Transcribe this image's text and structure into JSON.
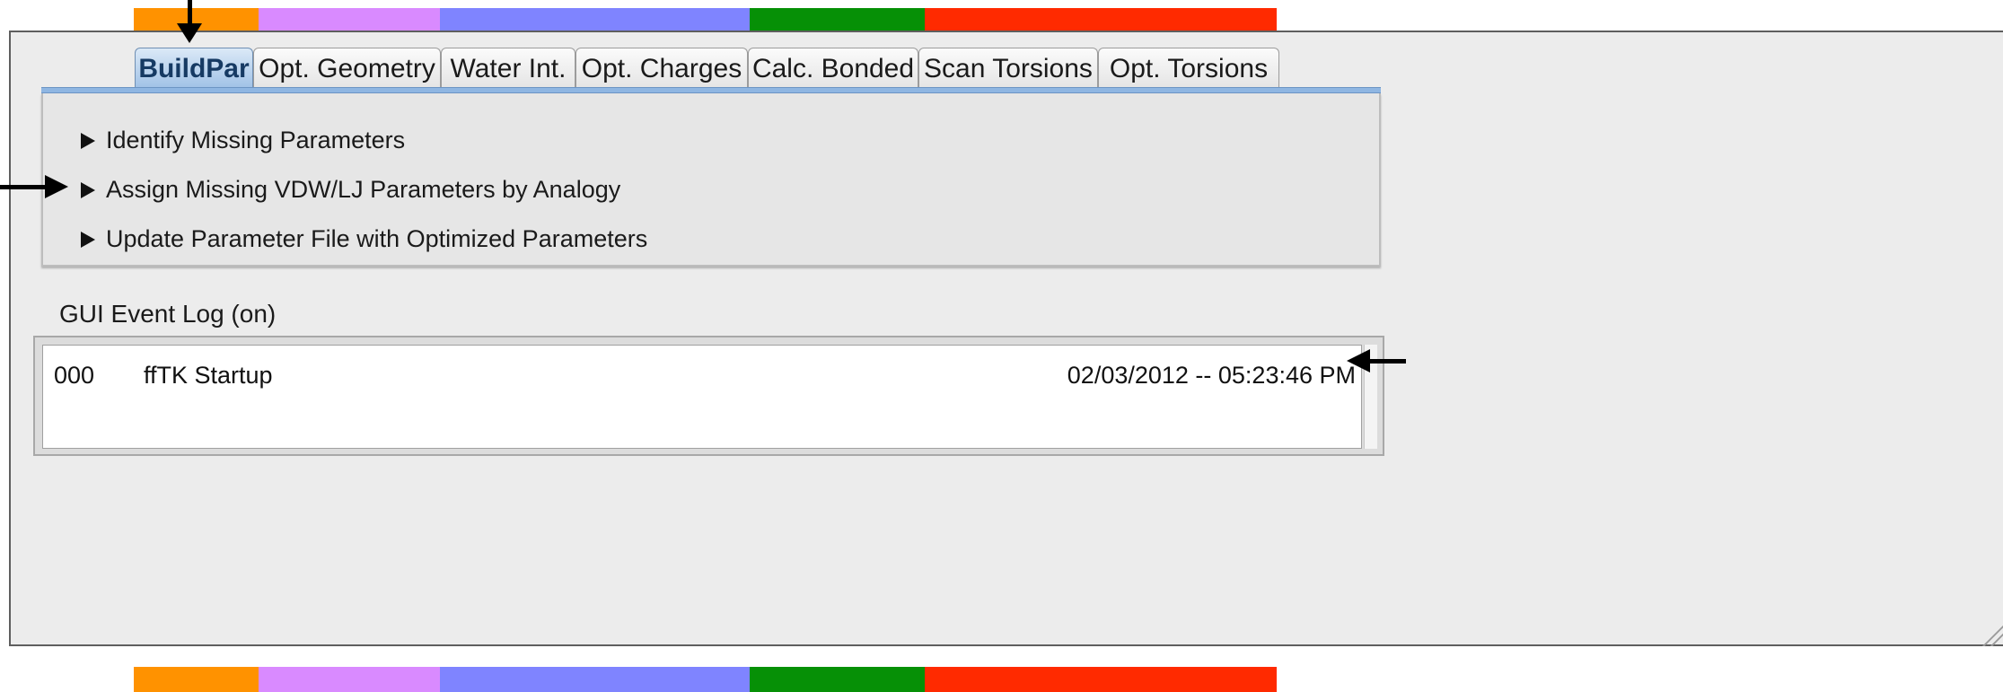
{
  "strip_colors": [
    "#ff9200",
    "#d98aff",
    "#7f84ff",
    "#069006",
    "#ff2a00"
  ],
  "tabs": [
    {
      "label": "BuildPar",
      "active": true
    },
    {
      "label": "Opt. Geometry",
      "active": false
    },
    {
      "label": "Water Int.",
      "active": false
    },
    {
      "label": "Opt. Charges",
      "active": false
    },
    {
      "label": "Calc. Bonded",
      "active": false
    },
    {
      "label": "Scan Torsions",
      "active": false
    },
    {
      "label": "Opt. Torsions",
      "active": false
    }
  ],
  "sections": [
    {
      "label": "Identify Missing Parameters"
    },
    {
      "label": "Assign Missing VDW/LJ Parameters by Analogy"
    },
    {
      "label": "Update Parameter File with Optimized Parameters"
    }
  ],
  "event_log": {
    "label": "GUI Event Log (on)",
    "entries": [
      {
        "num": "000",
        "message": "ffTK Startup",
        "timestamp": "02/03/2012 -- 05:23:46 PM"
      }
    ]
  },
  "accent_color": "#8fb6e2"
}
